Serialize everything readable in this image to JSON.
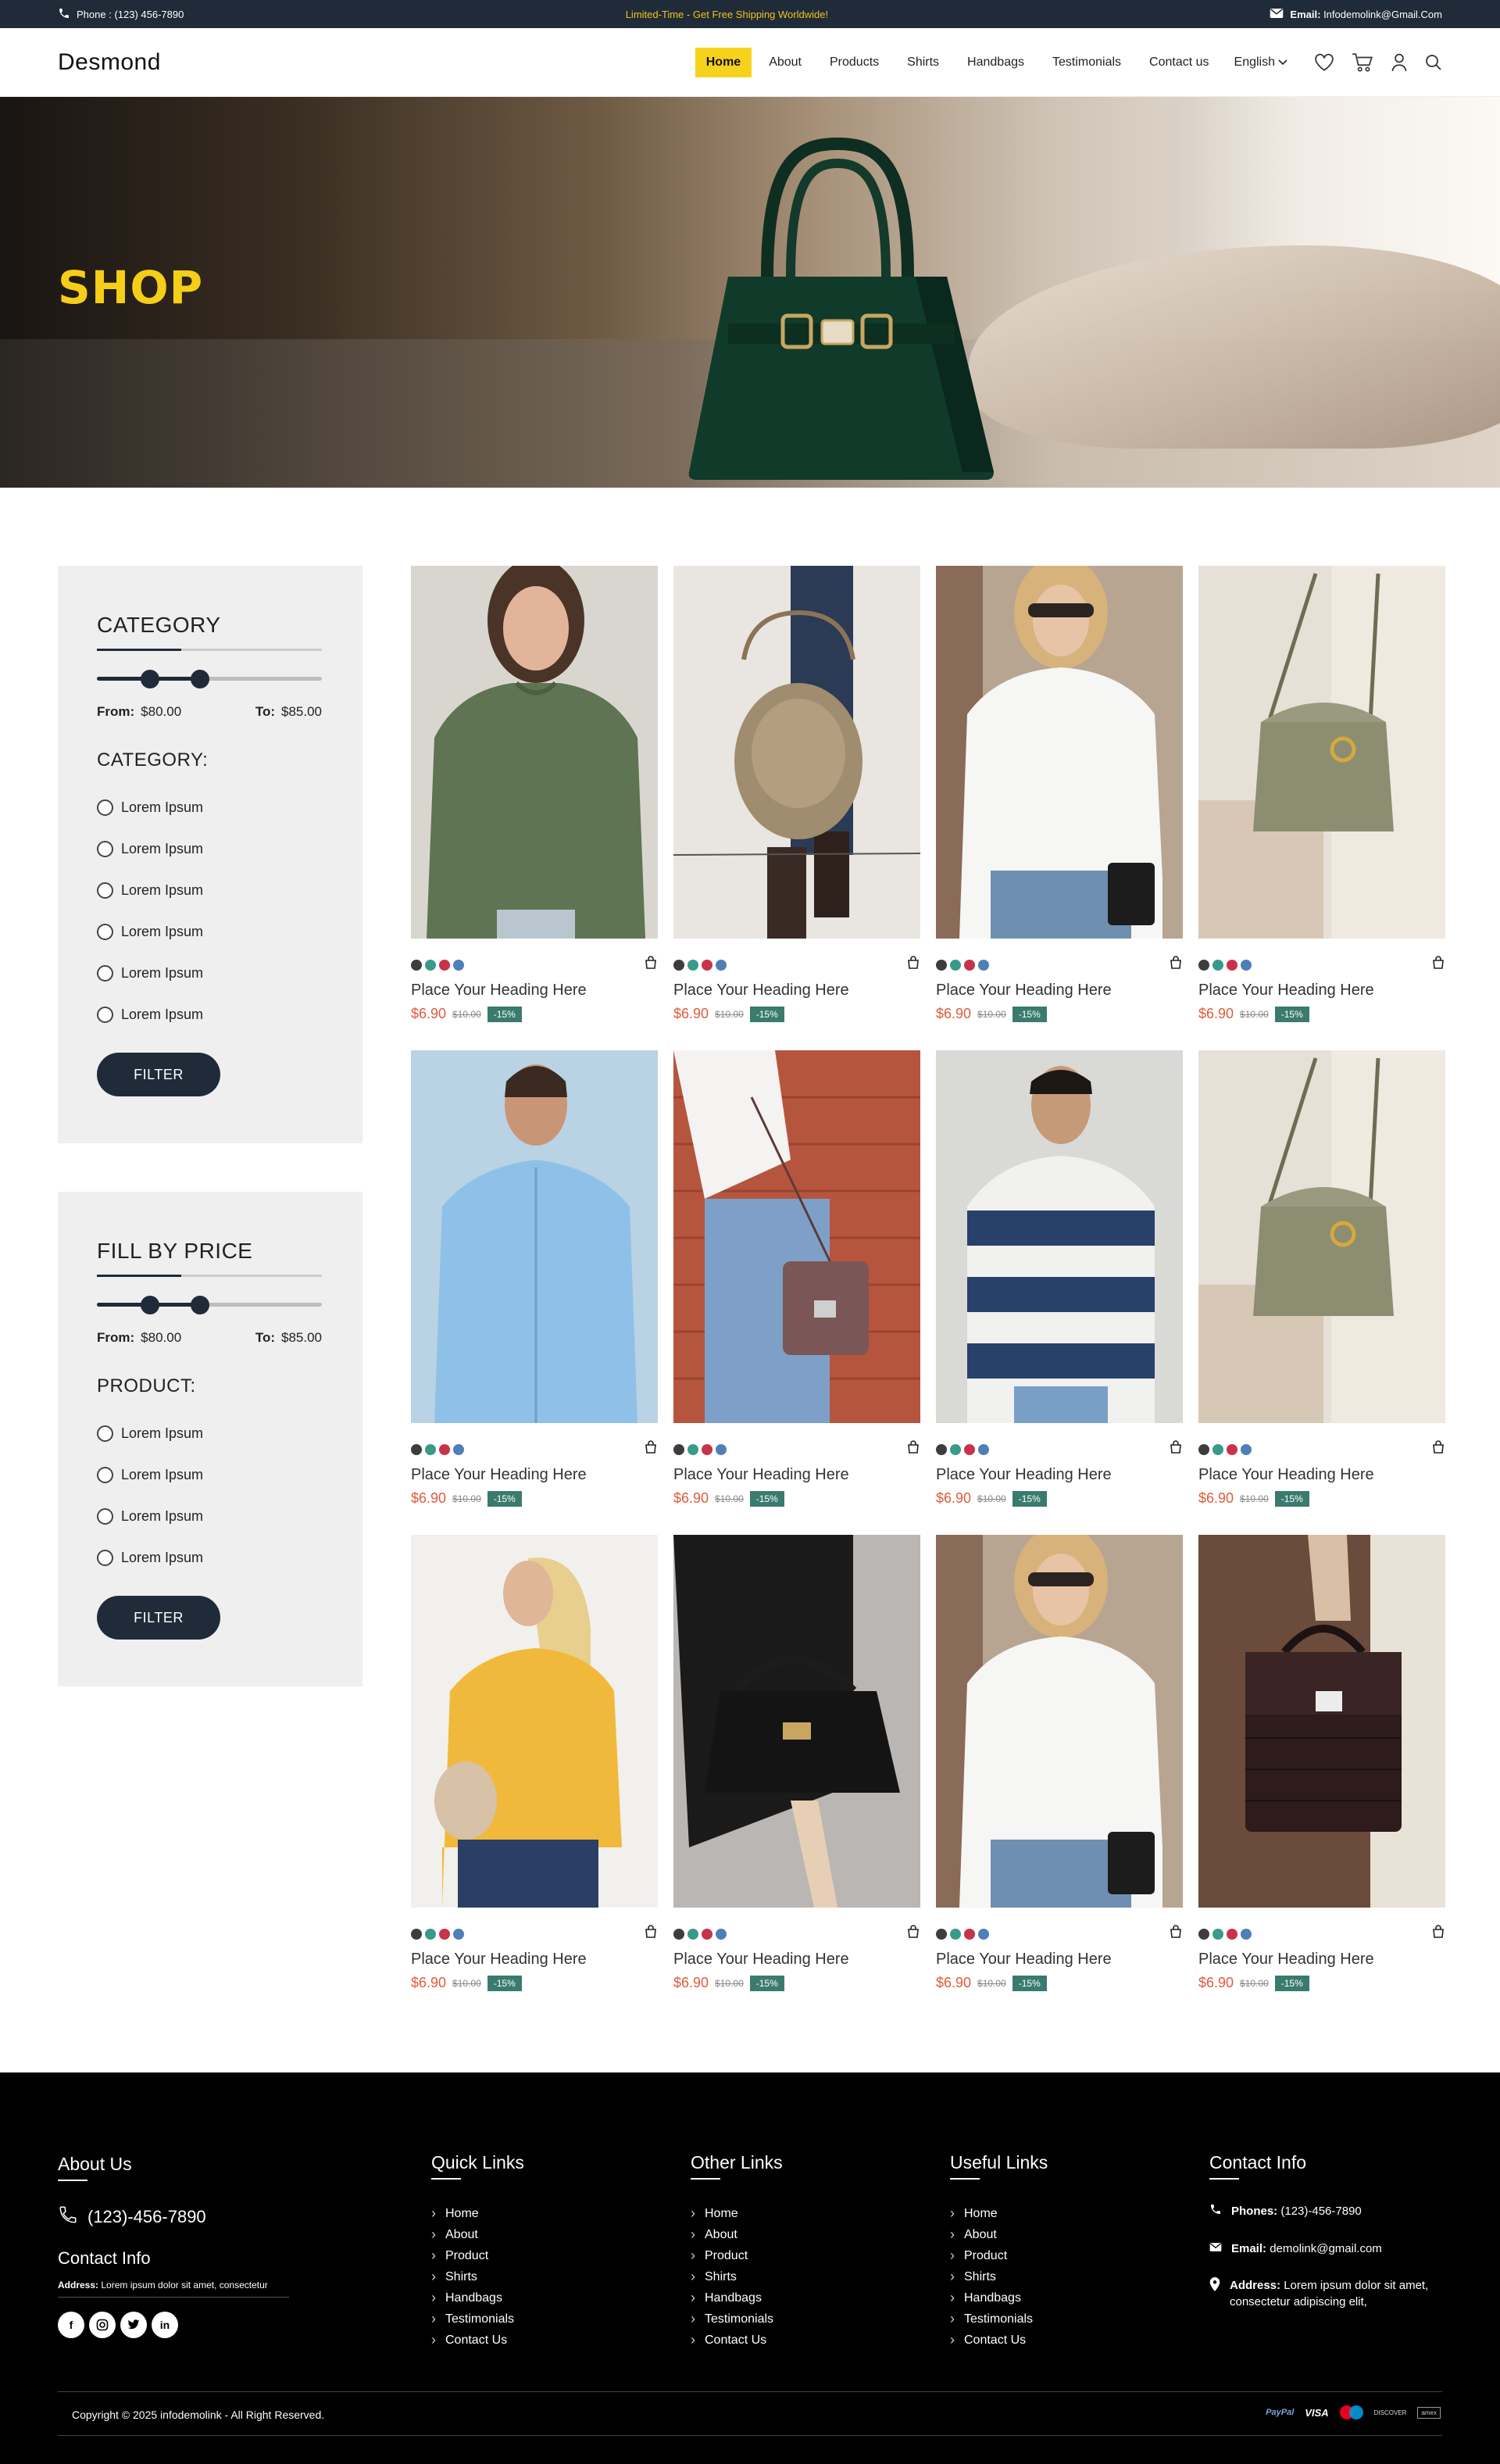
{
  "topbar": {
    "phone_label": "Phone :",
    "phone": "(123) 456-7890",
    "promo": "Limited-Time - Get Free Shipping Worldwide!",
    "email_label": "Email:",
    "email": "Infodemolink@Gmail.Com"
  },
  "header": {
    "logo": "Desmond",
    "nav": [
      "Home",
      "About",
      "Products",
      "Shirts",
      "Handbags",
      "Testimonials",
      "Contact us"
    ],
    "active": "Home",
    "language": "English"
  },
  "hero": {
    "title": "SHOP"
  },
  "sidebar": {
    "category_panel": {
      "title": "CATEGORY",
      "from_label": "From:",
      "from": "$80.00",
      "to_label": "To:",
      "to": "$85.00",
      "subheading": "CATEGORY:",
      "options": [
        "Lorem Ipsum",
        "Lorem Ipsum",
        "Lorem Ipsum",
        "Lorem Ipsum",
        "Lorem Ipsum",
        "Lorem Ipsum"
      ],
      "button": "FILTER"
    },
    "price_panel": {
      "title": "FILL BY PRICE",
      "from_label": "From:",
      "from": "$80.00",
      "to_label": "To:",
      "to": "$85.00",
      "subheading": "PRODUCT:",
      "options": [
        "Lorem Ipsum",
        "Lorem Ipsum",
        "Lorem Ipsum",
        "Lorem Ipsum"
      ],
      "button": "FILTER"
    }
  },
  "swatch_colors": [
    "#3d3d3d",
    "#3a9a8a",
    "#c8324a",
    "#4f7fb8"
  ],
  "products": [
    {
      "title": "Place Your Heading Here",
      "price": "$6.90",
      "old_price": "$10.00",
      "discount": "-15%",
      "image": "green-tshirt"
    },
    {
      "title": "Place Your Heading Here",
      "price": "$6.90",
      "old_price": "$10.00",
      "discount": "-15%",
      "image": "tan-hobo-bag"
    },
    {
      "title": "Place Your Heading Here",
      "price": "$6.90",
      "old_price": "$10.00",
      "discount": "-15%",
      "image": "white-shirt"
    },
    {
      "title": "Place Your Heading Here",
      "price": "$6.90",
      "old_price": "$10.00",
      "discount": "-15%",
      "image": "olive-bag"
    },
    {
      "title": "Place Your Heading Here",
      "price": "$6.90",
      "old_price": "$10.00",
      "discount": "-15%",
      "image": "blue-shirt-man"
    },
    {
      "title": "Place Your Heading Here",
      "price": "$6.90",
      "old_price": "$10.00",
      "discount": "-15%",
      "image": "mauve-crossbody"
    },
    {
      "title": "Place Your Heading Here",
      "price": "$6.90",
      "old_price": "$10.00",
      "discount": "-15%",
      "image": "striped-sweater"
    },
    {
      "title": "Place Your Heading Here",
      "price": "$6.90",
      "old_price": "$10.00",
      "discount": "-15%",
      "image": "olive-bag"
    },
    {
      "title": "Place Your Heading Here",
      "price": "$6.90",
      "old_price": "$10.00",
      "discount": "-15%",
      "image": "yellow-top"
    },
    {
      "title": "Place Your Heading Here",
      "price": "$6.90",
      "old_price": "$10.00",
      "discount": "-15%",
      "image": "black-handbag"
    },
    {
      "title": "Place Your Heading Here",
      "price": "$6.90",
      "old_price": "$10.00",
      "discount": "-15%",
      "image": "white-shirt"
    },
    {
      "title": "Place Your Heading Here",
      "price": "$6.90",
      "old_price": "$10.00",
      "discount": "-15%",
      "image": "croc-handbag"
    }
  ],
  "footer": {
    "about": {
      "title": "About Us",
      "phone": "(123)-456-7890",
      "contact_title": "Contact Info",
      "address_label": "Address:",
      "address": "Lorem ipsum dolor sit amet, consectetur",
      "socials": [
        "f",
        "ig",
        "tw",
        "in"
      ]
    },
    "quick_links": {
      "title": "Quick Links",
      "items": [
        "Home",
        "About",
        "Product",
        "Shirts",
        "Handbags",
        "Testimonials",
        "Contact Us"
      ]
    },
    "other_links": {
      "title": "Other Links",
      "items": [
        "Home",
        "About",
        "Product",
        "Shirts",
        "Handbags",
        "Testimonials",
        "Contact Us"
      ]
    },
    "useful_links": {
      "title": "Useful Links",
      "items": [
        "Home",
        "About",
        "Product",
        "Shirts",
        "Handbags",
        "Testimonials",
        "Contact Us"
      ]
    },
    "contact": {
      "title": "Contact Info",
      "phones_label": "Phones:",
      "phones": "(123)-456-7890",
      "email_label": "Email:",
      "email": "demolink@gmail.com",
      "address_label": "Address:",
      "address": "Lorem ipsum dolor sit amet, consectetur adipiscing elit,"
    },
    "copyright": "Copyright © 2025 infodemolink - All Right Reserved.",
    "payments": [
      "PayPal",
      "VISA",
      "mastercard",
      "DISCOVER",
      "amex"
    ]
  }
}
